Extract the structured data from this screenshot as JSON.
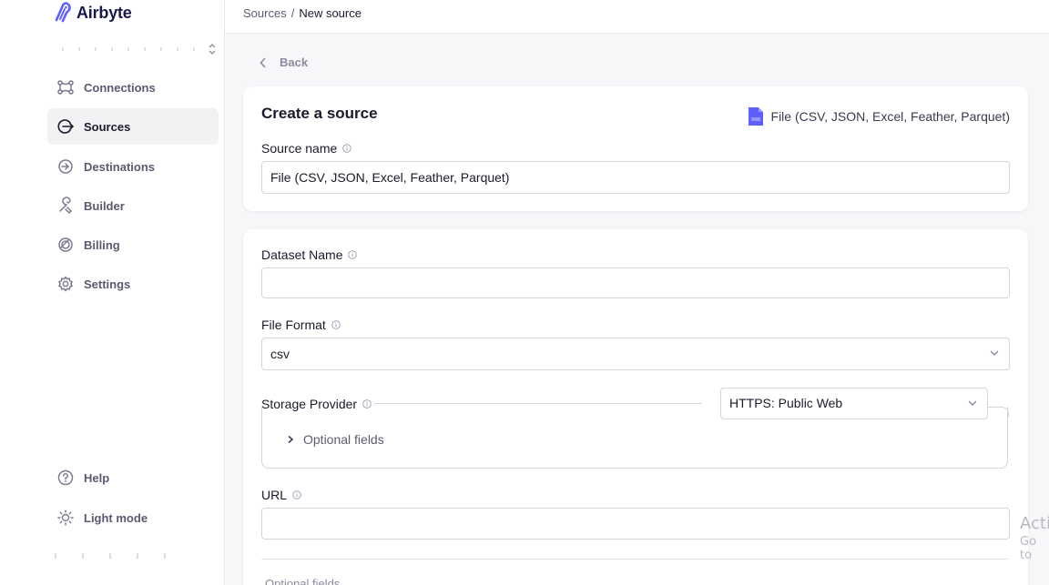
{
  "app": {
    "name": "Airbyte"
  },
  "sidebar": {
    "items": [
      {
        "label": "Connections",
        "icon": "connections-icon"
      },
      {
        "label": "Sources",
        "icon": "sources-icon",
        "active": true
      },
      {
        "label": "Destinations",
        "icon": "destinations-icon"
      },
      {
        "label": "Builder",
        "icon": "builder-icon"
      },
      {
        "label": "Billing",
        "icon": "billing-icon"
      },
      {
        "label": "Settings",
        "icon": "gear-icon"
      }
    ],
    "bottom": [
      {
        "label": "Help",
        "icon": "help-icon"
      },
      {
        "label": "Light mode",
        "icon": "sun-icon"
      }
    ]
  },
  "breadcrumb": {
    "parent": "Sources",
    "separator": "/",
    "current": "New source"
  },
  "back": {
    "label": "Back"
  },
  "source_card": {
    "title": "Create a source",
    "connector_name": "File (CSV, JSON, Excel, Feather, Parquet)",
    "source_name_label": "Source name",
    "source_name_value": "File (CSV, JSON, Excel, Feather, Parquet)"
  },
  "config": {
    "dataset_name_label": "Dataset Name",
    "dataset_name_value": "",
    "file_format_label": "File Format",
    "file_format_value": "csv",
    "storage_provider_label": "Storage Provider",
    "storage_provider_value": "HTTPS: Public Web",
    "optional_fields_label": "Optional fields",
    "url_label": "URL",
    "url_value": ""
  },
  "watermark": {
    "line1": "Acti",
    "line2": "Go to"
  },
  "colors": {
    "brand": "#615eff",
    "brand_dark": "#1a194d",
    "text": "#1a1a2e",
    "muted": "#5a5a72",
    "border": "#d4d4dc",
    "bg": "#f7f7fa"
  }
}
